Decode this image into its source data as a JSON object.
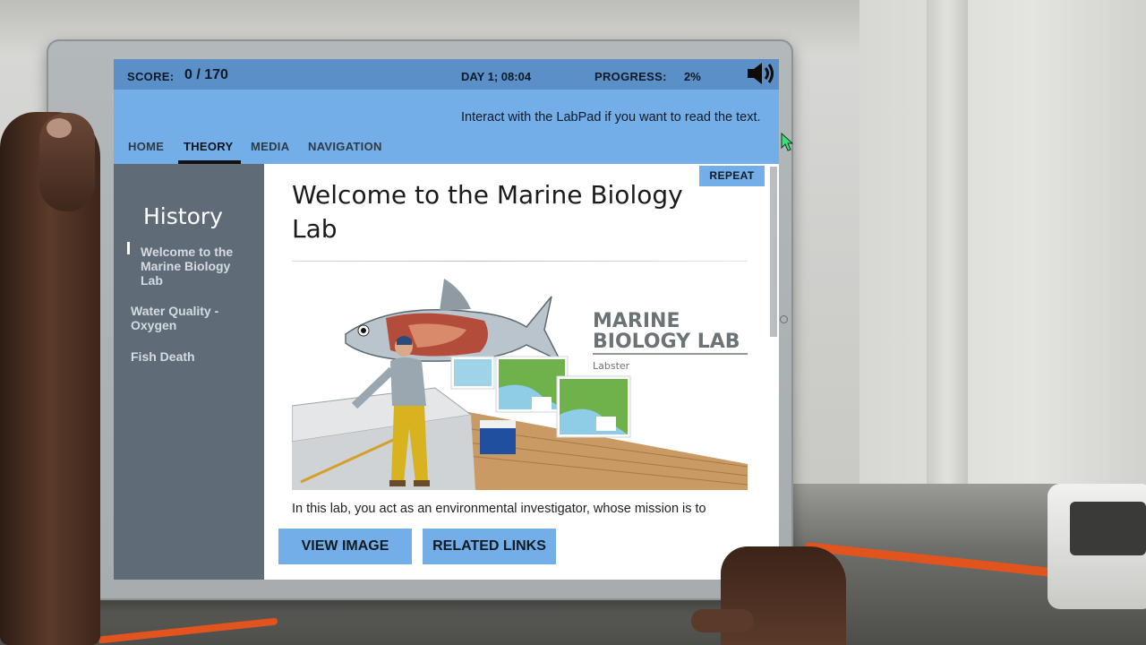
{
  "topbar": {
    "score_label": "SCORE:",
    "score_value": "0 / 170",
    "day": "DAY 1; 08:04",
    "progress_label": "PROGRESS:",
    "progress_value": "2%",
    "speaker_icon": "speaker-icon"
  },
  "nav": {
    "tabs": [
      {
        "label": "HOME",
        "active": false
      },
      {
        "label": "THEORY",
        "active": true
      },
      {
        "label": "MEDIA",
        "active": false
      },
      {
        "label": "NAVIGATION",
        "active": false
      }
    ],
    "hint": "Interact with the LabPad if you want to read the text."
  },
  "sidebar": {
    "title": "History",
    "items": [
      {
        "label": "Welcome to the Marine Biology Lab",
        "active": true
      },
      {
        "label": "Water Quality - Oxygen",
        "active": false
      },
      {
        "label": "Fish Death",
        "active": false
      }
    ]
  },
  "content": {
    "repeat_label": "REPEAT",
    "title": "Welcome to the Marine Biology Lab",
    "hero": {
      "logo_line1": "MARINE",
      "logo_line2": "BIOLOGY LAB",
      "logo_brand": "Labster"
    },
    "body_text": "In this lab, you act as an environmental investigator, whose mission is to",
    "view_image_label": "VIEW IMAGE",
    "related_links_label": "RELATED LINKS"
  },
  "colors": {
    "topbar": "#5b8fc8",
    "navbar": "#73aee8",
    "sidebar": "#5f6c77",
    "accent_button": "#73aee8"
  }
}
